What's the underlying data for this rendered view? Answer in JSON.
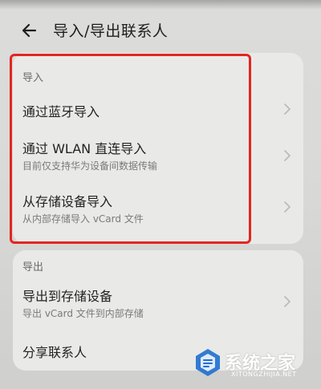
{
  "header": {
    "title": "导入/导出联系人"
  },
  "import_section": {
    "label": "导入",
    "items": [
      {
        "title": "通过蓝牙导入",
        "subtitle": ""
      },
      {
        "title": "通过 WLAN 直连导入",
        "subtitle": "目前仅支持华为设备间数据传输"
      },
      {
        "title": "从存储设备导入",
        "subtitle": "从内部存储导入 vCard 文件"
      }
    ]
  },
  "export_section": {
    "label": "导出",
    "items": [
      {
        "title": "导出到存储设备",
        "subtitle": "导出 vCard 文件到内部存储"
      },
      {
        "title": "分享联系人",
        "subtitle": ""
      }
    ]
  },
  "watermark": {
    "text": "系统之家",
    "url": "XITONGZHIJIA.NET"
  },
  "colors": {
    "highlight": "#e42520",
    "card": "#e9e9e7",
    "background": "#d9d9d7"
  }
}
